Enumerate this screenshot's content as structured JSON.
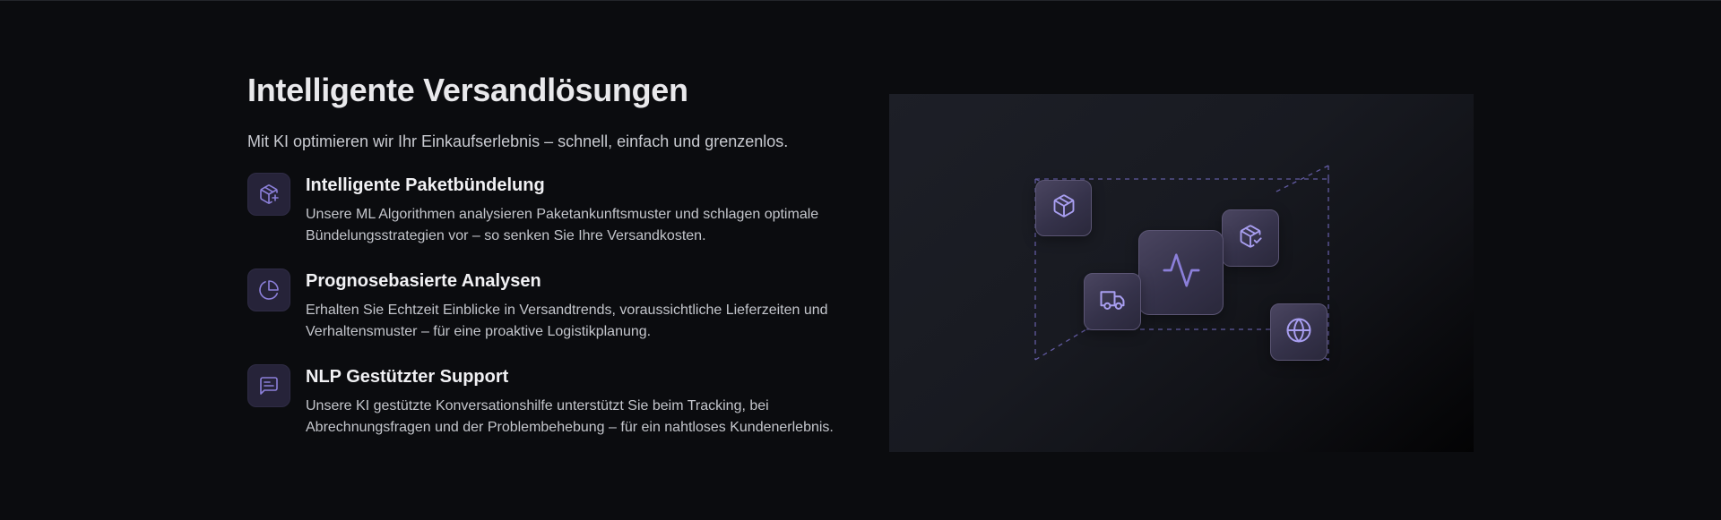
{
  "section": {
    "title": "Intelligente Versandlösungen",
    "subtitle": "Mit KI optimieren wir Ihr Einkaufserlebnis – schnell, einfach und grenzenlos."
  },
  "features": [
    {
      "icon": "package-plus-icon",
      "title": "Intelligente Paketbündelung",
      "description": "Unsere ML Algorithmen analysieren Paketankunftsmuster und schlagen optimale Bündelungsstrategien vor – so senken Sie Ihre Versandkosten."
    },
    {
      "icon": "pie-chart-icon",
      "title": "Prognosebasierte Analysen",
      "description": "Erhalten Sie Echtzeit Einblicke in Versandtrends, voraussichtliche Lieferzeiten und Verhaltensmuster – für eine proaktive Logistikplanung."
    },
    {
      "icon": "message-square-text-icon",
      "title": "NLP Gestützter Support",
      "description": "Unsere KI gestützte Konversationshilfe unterstützt Sie beim Tracking, bei Abrechnungsfragen und der Problembehebung – für ein nahtloses Kundenerlebnis."
    }
  ],
  "illustration": {
    "tiles": [
      "box-icon",
      "package-check-icon",
      "activity-icon",
      "truck-icon",
      "globe-icon"
    ]
  },
  "colors": {
    "background": "#0b0c0f",
    "accent": "#8b7fd9",
    "icon_tile": "#262339"
  }
}
